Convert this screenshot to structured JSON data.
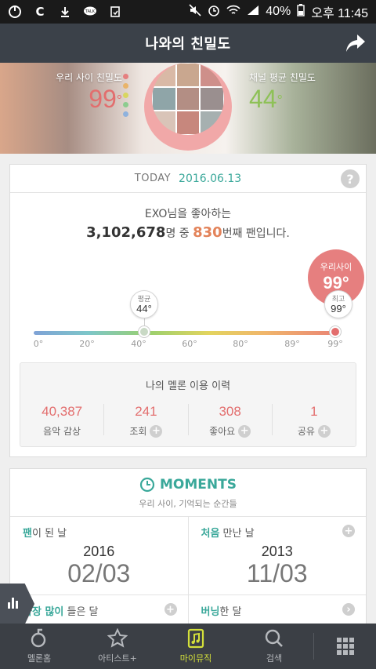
{
  "statusbar": {
    "battery": "40%",
    "time": "오후 11:45"
  },
  "header": {
    "title": "나와의 친밀도"
  },
  "hero": {
    "our_label": "우리 사이 친밀도",
    "our_value": "99",
    "channel_label": "채널 평균 친밀도",
    "channel_value": "44",
    "degree": "°"
  },
  "today": {
    "label": "TODAY",
    "date": "2016.06.13",
    "help": "?",
    "line1": "EXO님을 좋아하는",
    "fans_total": "3,102,678",
    "unit_person": "명 중",
    "rank": "830",
    "rank_suffix": "번째 팬입니다."
  },
  "gauge": {
    "ours_label": "우리사이",
    "ours_value": "99°",
    "avg_label": "평균",
    "avg_value": "44°",
    "max_label": "최고",
    "max_value": "99°",
    "ticks": [
      "0°",
      "20°",
      "40°",
      "60°",
      "80°",
      "89°",
      "99°"
    ]
  },
  "history": {
    "title": "나의 멜론 이용 이력",
    "items": [
      {
        "value": "40,387",
        "label": "음악 감상"
      },
      {
        "value": "241",
        "label": "조회"
      },
      {
        "value": "308",
        "label": "좋아요"
      },
      {
        "value": "1",
        "label": "공유"
      }
    ]
  },
  "moments": {
    "title": "MOMENTS",
    "subtitle": "우리 사이, 기억되는 순간들",
    "fan_day": {
      "accent": "팬",
      "rest": "이 된 날",
      "year": "2016",
      "date": "02/03"
    },
    "first_met": {
      "accent": "처음",
      "rest": " 만난 날",
      "year": "2013",
      "date": "11/03"
    },
    "most_listened": {
      "accent": "가장 많이",
      "rest": " 들은 달"
    },
    "burning": {
      "accent": "버닝",
      "rest": "한 달"
    }
  },
  "bottomnav": {
    "items": [
      {
        "label": "멜론홈"
      },
      {
        "label": "아티스트+"
      },
      {
        "label": "마이뮤직"
      },
      {
        "label": "검색"
      }
    ]
  },
  "colors": {
    "accent_teal": "#3aa89a",
    "accent_pink": "#e36e6e",
    "accent_orange": "#e3835a",
    "nav_active": "#d4e03a"
  }
}
